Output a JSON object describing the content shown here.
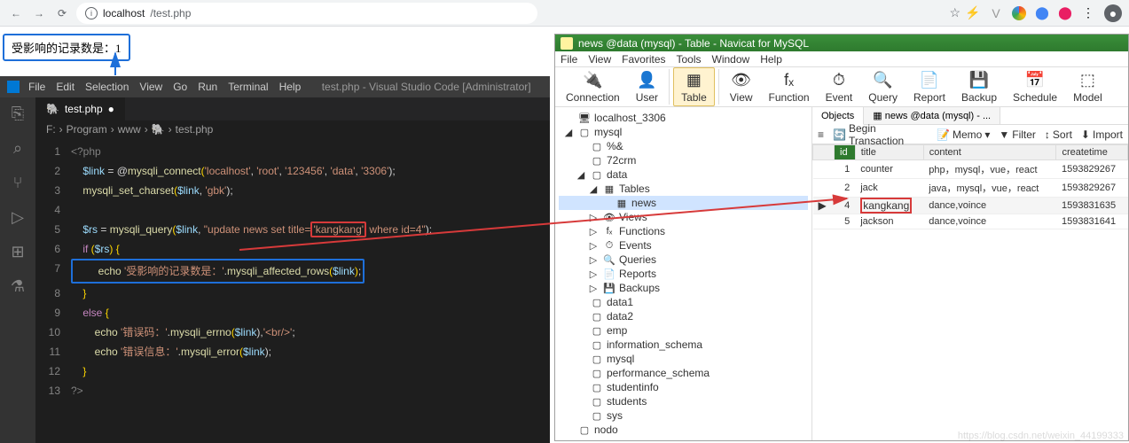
{
  "browser": {
    "url_host": "localhost",
    "url_path": "/test.php"
  },
  "page_output": "受影响的记录数是：1",
  "vscode": {
    "menu": [
      "File",
      "Edit",
      "Selection",
      "View",
      "Go",
      "Run",
      "Terminal",
      "Help"
    ],
    "title": "test.php - Visual Studio Code [Administrator]",
    "tab": "test.php",
    "breadcrumb": [
      "F:",
      "Program",
      "www",
      "🐘",
      "test.php"
    ],
    "code": [
      {
        "n": 1,
        "seg": [
          {
            "t": "<?php",
            "c": "tok-tag"
          }
        ]
      },
      {
        "n": 2,
        "seg": [
          {
            "t": "    ",
            "c": ""
          },
          {
            "t": "$link",
            "c": "tok-var"
          },
          {
            "t": " = @",
            "c": "tok-op"
          },
          {
            "t": "mysqli_connect",
            "c": "tok-fn"
          },
          {
            "t": "(",
            "c": "tok-br"
          },
          {
            "t": "'localhost'",
            "c": "tok-str"
          },
          {
            "t": ", ",
            "c": "tok-op"
          },
          {
            "t": "'root'",
            "c": "tok-str"
          },
          {
            "t": ", ",
            "c": "tok-op"
          },
          {
            "t": "'123456'",
            "c": "tok-str"
          },
          {
            "t": ", ",
            "c": "tok-op"
          },
          {
            "t": "'data'",
            "c": "tok-str"
          },
          {
            "t": ", ",
            "c": "tok-op"
          },
          {
            "t": "'3306'",
            "c": "tok-str"
          },
          {
            "t": ");",
            "c": "tok-op"
          }
        ]
      },
      {
        "n": 3,
        "seg": [
          {
            "t": "    ",
            "c": ""
          },
          {
            "t": "mysqli_set_charset",
            "c": "tok-fn"
          },
          {
            "t": "(",
            "c": "tok-br"
          },
          {
            "t": "$link",
            "c": "tok-var"
          },
          {
            "t": ", ",
            "c": "tok-op"
          },
          {
            "t": "'gbk'",
            "c": "tok-str"
          },
          {
            "t": ");",
            "c": "tok-op"
          }
        ]
      },
      {
        "n": 4,
        "seg": []
      },
      {
        "n": 5,
        "seg": [
          {
            "t": "    ",
            "c": ""
          },
          {
            "t": "$rs",
            "c": "tok-var"
          },
          {
            "t": " = ",
            "c": "tok-op"
          },
          {
            "t": "mysqli_query",
            "c": "tok-fn"
          },
          {
            "t": "(",
            "c": "tok-br"
          },
          {
            "t": "$link",
            "c": "tok-var"
          },
          {
            "t": ", ",
            "c": "tok-op"
          },
          {
            "t": "\"update news set title=",
            "c": "tok-str"
          },
          {
            "t": "'kangkang'",
            "c": "tok-str hl-red"
          },
          {
            "t": " where id=4\"",
            "c": "tok-str"
          },
          {
            "t": ");",
            "c": "tok-op"
          }
        ]
      },
      {
        "n": 6,
        "seg": [
          {
            "t": "    ",
            "c": ""
          },
          {
            "t": "if",
            "c": "tok-kw"
          },
          {
            "t": " (",
            "c": "tok-br"
          },
          {
            "t": "$rs",
            "c": "tok-var"
          },
          {
            "t": ") ",
            "c": "tok-br"
          },
          {
            "t": "{",
            "c": "tok-br"
          }
        ]
      },
      {
        "n": 7,
        "hl": "blue",
        "seg": [
          {
            "t": "        ",
            "c": ""
          },
          {
            "t": "echo",
            "c": "tok-fn"
          },
          {
            "t": " ",
            "c": ""
          },
          {
            "t": "'受影响的记录数是：'",
            "c": "tok-str"
          },
          {
            "t": ".",
            "c": "tok-op"
          },
          {
            "t": "mysqli_affected_rows",
            "c": "tok-fn"
          },
          {
            "t": "(",
            "c": "tok-br"
          },
          {
            "t": "$link",
            "c": "tok-var"
          },
          {
            "t": ")",
            "c": "tok-br"
          },
          {
            "t": ";",
            "c": "tok-op"
          }
        ]
      },
      {
        "n": 8,
        "seg": [
          {
            "t": "    ",
            "c": ""
          },
          {
            "t": "}",
            "c": "tok-br"
          }
        ]
      },
      {
        "n": 9,
        "seg": [
          {
            "t": "    ",
            "c": ""
          },
          {
            "t": "else",
            "c": "tok-kw"
          },
          {
            "t": " ",
            "c": ""
          },
          {
            "t": "{",
            "c": "tok-br"
          }
        ]
      },
      {
        "n": 10,
        "seg": [
          {
            "t": "        ",
            "c": ""
          },
          {
            "t": "echo",
            "c": "tok-fn"
          },
          {
            "t": " ",
            "c": ""
          },
          {
            "t": "'错误码：'",
            "c": "tok-str"
          },
          {
            "t": ".",
            "c": "tok-op"
          },
          {
            "t": "mysqli_errno",
            "c": "tok-fn"
          },
          {
            "t": "(",
            "c": "tok-br"
          },
          {
            "t": "$link",
            "c": "tok-var"
          },
          {
            "t": "),",
            "c": "tok-op"
          },
          {
            "t": "'<br/>'",
            "c": "tok-str"
          },
          {
            "t": ";",
            "c": "tok-op"
          }
        ]
      },
      {
        "n": 11,
        "seg": [
          {
            "t": "        ",
            "c": ""
          },
          {
            "t": "echo",
            "c": "tok-fn"
          },
          {
            "t": " ",
            "c": ""
          },
          {
            "t": "'错误信息：'",
            "c": "tok-str"
          },
          {
            "t": ".",
            "c": "tok-op"
          },
          {
            "t": "mysqli_error",
            "c": "tok-fn"
          },
          {
            "t": "(",
            "c": "tok-br"
          },
          {
            "t": "$link",
            "c": "tok-var"
          },
          {
            "t": ");",
            "c": "tok-op"
          }
        ]
      },
      {
        "n": 12,
        "seg": [
          {
            "t": "    ",
            "c": ""
          },
          {
            "t": "}",
            "c": "tok-br"
          }
        ]
      },
      {
        "n": 13,
        "seg": [
          {
            "t": "?>",
            "c": "tok-tag"
          }
        ]
      }
    ]
  },
  "navicat": {
    "title": "news @data (mysql) - Table - Navicat for MySQL",
    "menu": [
      "File",
      "View",
      "Favorites",
      "Tools",
      "Window",
      "Help"
    ],
    "toolbar": [
      {
        "label": "Connection",
        "icon": "🔌"
      },
      {
        "label": "User",
        "icon": "👤"
      },
      {
        "label": "Table",
        "icon": "▦",
        "active": true
      },
      {
        "label": "View",
        "icon": "👁"
      },
      {
        "label": "Function",
        "icon": "fₓ"
      },
      {
        "label": "Event",
        "icon": "⏱"
      },
      {
        "label": "Query",
        "icon": "🔍"
      },
      {
        "label": "Report",
        "icon": "📄"
      },
      {
        "label": "Backup",
        "icon": "💾"
      },
      {
        "label": "Schedule",
        "icon": "📅"
      },
      {
        "label": "Model",
        "icon": "⬚"
      }
    ],
    "tree": [
      {
        "ind": 0,
        "ic": "🖥",
        "label": "localhost_3306"
      },
      {
        "ind": 0,
        "ic": "▢",
        "label": "mysql",
        "pre": "◢"
      },
      {
        "ind": 1,
        "ic": "▢",
        "label": "%&"
      },
      {
        "ind": 1,
        "ic": "▢",
        "label": "72crm"
      },
      {
        "ind": 1,
        "ic": "▢",
        "label": "data",
        "pre": "◢"
      },
      {
        "ind": 2,
        "ic": "▦",
        "label": "Tables",
        "pre": "◢"
      },
      {
        "ind": 3,
        "ic": "▦",
        "label": "news",
        "sel": true
      },
      {
        "ind": 2,
        "ic": "👁",
        "label": "Views",
        "pre": "▷"
      },
      {
        "ind": 2,
        "ic": "fₓ",
        "label": "Functions",
        "pre": "▷"
      },
      {
        "ind": 2,
        "ic": "⏱",
        "label": "Events",
        "pre": "▷"
      },
      {
        "ind": 2,
        "ic": "🔍",
        "label": "Queries",
        "pre": "▷"
      },
      {
        "ind": 2,
        "ic": "📄",
        "label": "Reports",
        "pre": "▷"
      },
      {
        "ind": 2,
        "ic": "💾",
        "label": "Backups",
        "pre": "▷"
      },
      {
        "ind": 1,
        "ic": "▢",
        "label": "data1"
      },
      {
        "ind": 1,
        "ic": "▢",
        "label": "data2"
      },
      {
        "ind": 1,
        "ic": "▢",
        "label": "emp"
      },
      {
        "ind": 1,
        "ic": "▢",
        "label": "information_schema"
      },
      {
        "ind": 1,
        "ic": "▢",
        "label": "mysql"
      },
      {
        "ind": 1,
        "ic": "▢",
        "label": "performance_schema"
      },
      {
        "ind": 1,
        "ic": "▢",
        "label": "studentinfo"
      },
      {
        "ind": 1,
        "ic": "▢",
        "label": "students"
      },
      {
        "ind": 1,
        "ic": "▢",
        "label": "sys"
      },
      {
        "ind": 0,
        "ic": "▢",
        "label": "nodo"
      }
    ],
    "obj_tabs": [
      "Objects",
      "news @data (mysql) - ..."
    ],
    "obj_toolbar": {
      "hamburger": "≡",
      "begin": "Begin Transaction",
      "memo": "Memo",
      "filter": "Filter",
      "sort": "Sort",
      "import": "Import"
    },
    "columns": [
      "id",
      "title",
      "content",
      "createtime"
    ],
    "rows": [
      {
        "id": 1,
        "title": "counter",
        "content": "php，mysql，vue，react",
        "createtime": "1593829267"
      },
      {
        "id": 2,
        "title": "jack",
        "content": "java，mysql，vue，react",
        "createtime": "1593829267"
      },
      {
        "id": 4,
        "title": "kangkang",
        "content": "dance,voince",
        "createtime": "1593831635",
        "active": true,
        "hl": true
      },
      {
        "id": 5,
        "title": "jackson",
        "content": "dance,voince",
        "createtime": "1593831641"
      }
    ]
  },
  "watermark": "https://blog.csdn.net/weixin_44199333"
}
